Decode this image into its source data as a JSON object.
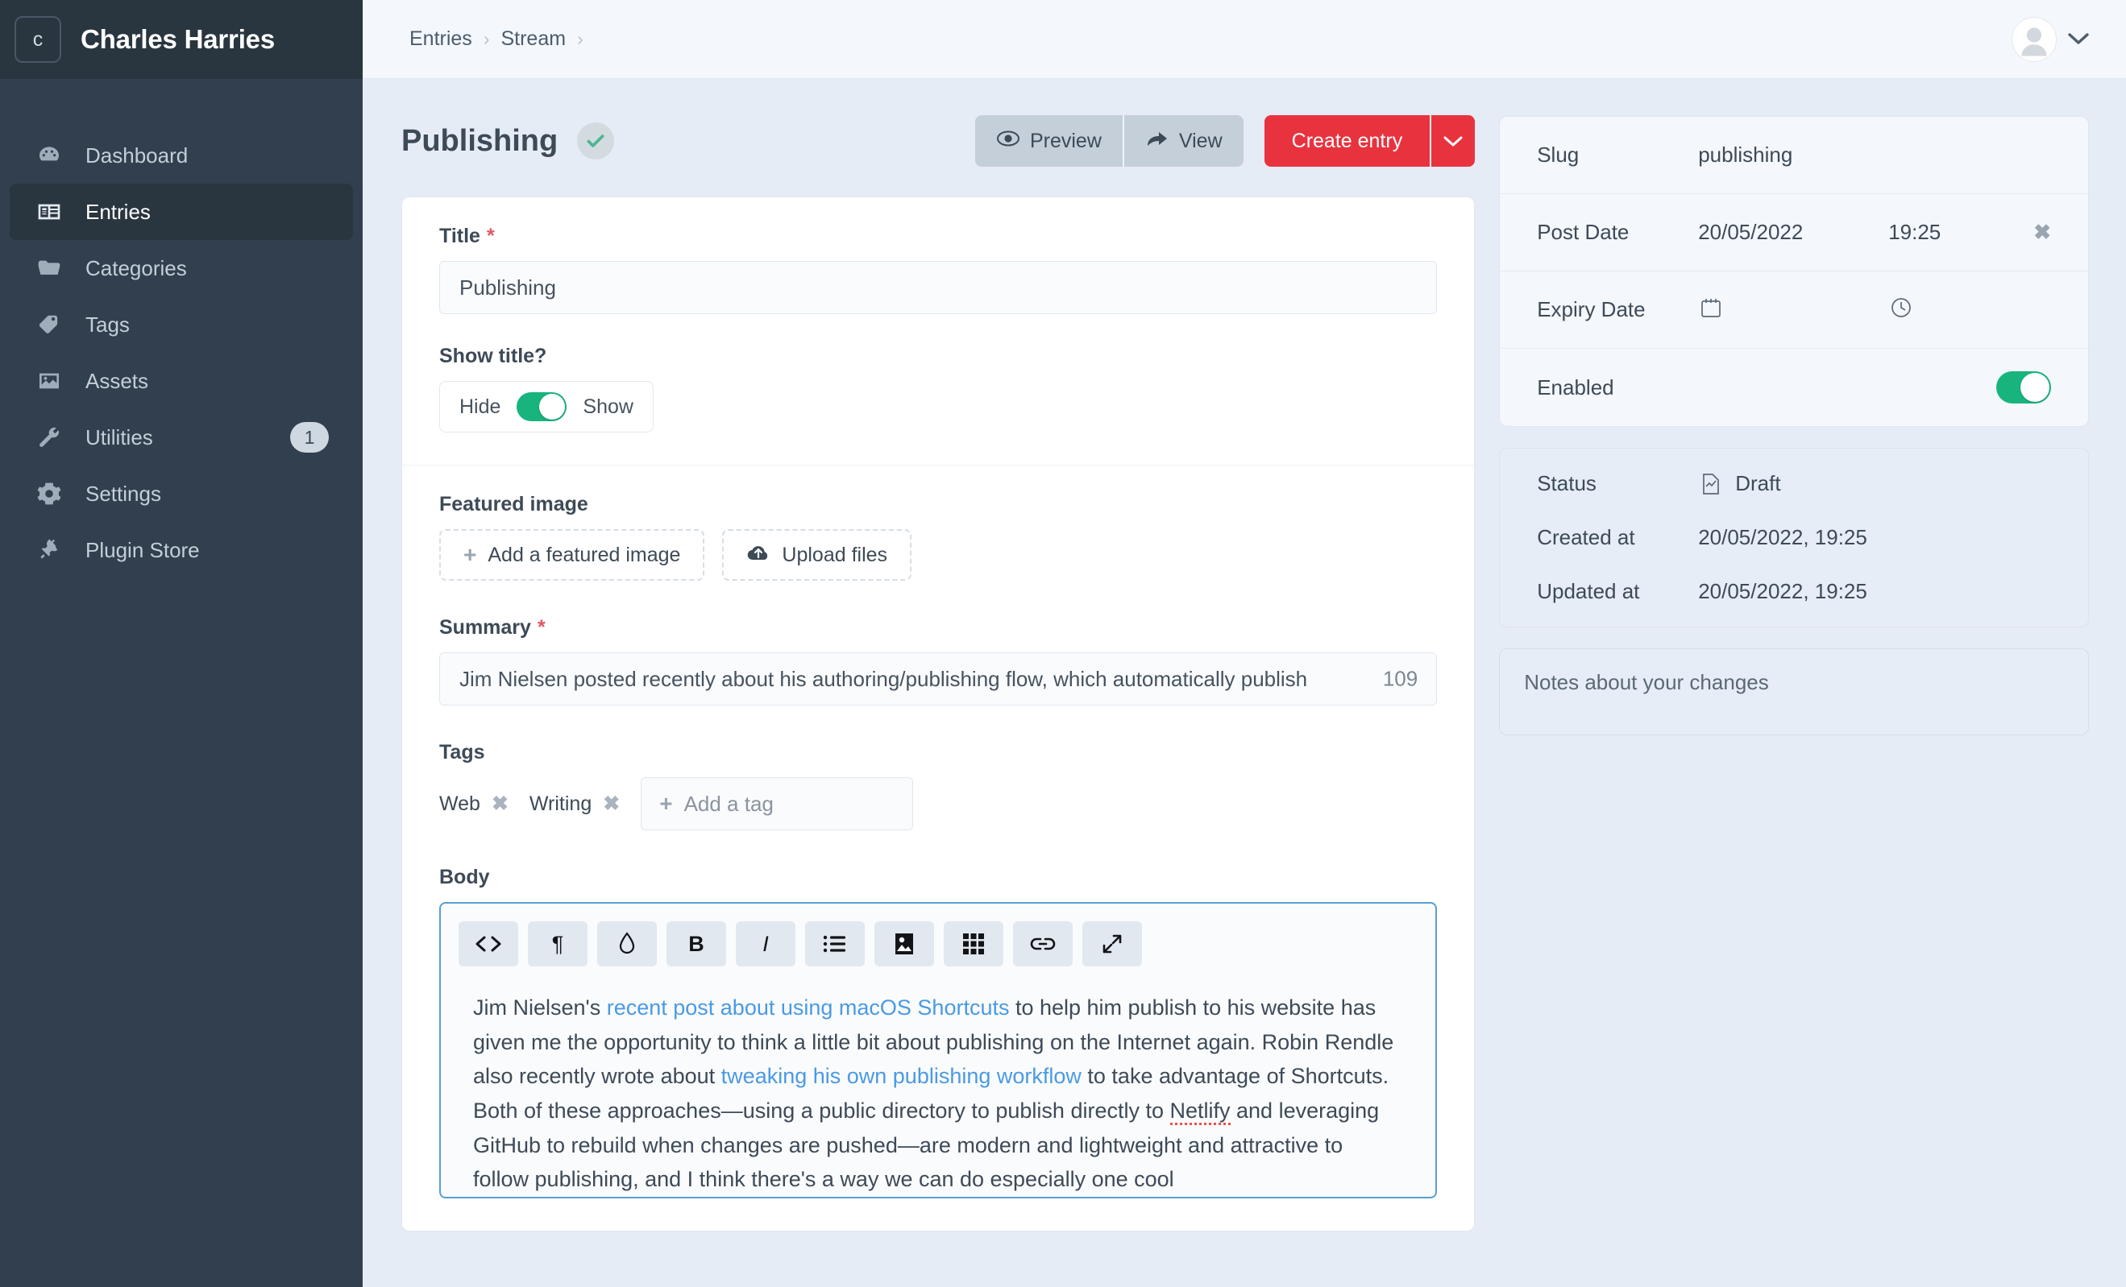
{
  "sidebar": {
    "brand": {
      "logo_letter": "c",
      "name": "Charles Harries"
    },
    "items": [
      {
        "label": "Dashboard",
        "icon": "dashboard-icon",
        "badge": ""
      },
      {
        "label": "Entries",
        "icon": "entries-icon",
        "badge": ""
      },
      {
        "label": "Categories",
        "icon": "folder-icon",
        "badge": ""
      },
      {
        "label": "Tags",
        "icon": "tag-icon",
        "badge": ""
      },
      {
        "label": "Assets",
        "icon": "image-icon",
        "badge": ""
      },
      {
        "label": "Utilities",
        "icon": "wrench-icon",
        "badge": "1"
      },
      {
        "label": "Settings",
        "icon": "gear-icon",
        "badge": ""
      },
      {
        "label": "Plugin Store",
        "icon": "plug-icon",
        "badge": ""
      }
    ]
  },
  "topbar": {
    "breadcrumb": [
      "Entries",
      "Stream"
    ],
    "separator": "›",
    "avatar_caret": "⌄"
  },
  "page": {
    "title": "Publishing",
    "saved_icon": "check-icon",
    "actions": {
      "preview": "Preview",
      "view": "View",
      "create": "Create entry",
      "create_caret": "⌄"
    }
  },
  "form": {
    "title_field": {
      "label": "Title",
      "required": "*",
      "value": "Publishing"
    },
    "show_title": {
      "label": "Show title?",
      "off_label": "Hide",
      "on_label": "Show",
      "state": "on"
    },
    "featured_image": {
      "label": "Featured image",
      "add_label": "Add a featured image",
      "upload_label": "Upload files"
    },
    "summary": {
      "label": "Summary",
      "required": "*",
      "value": "Jim Nielsen posted recently about his authoring/publishing flow, which automatically publish",
      "char_count": "109"
    },
    "tags": {
      "label": "Tags",
      "chips": [
        "Web",
        "Writing"
      ],
      "remove_glyph": "✖",
      "add_placeholder": "Add a tag"
    },
    "body": {
      "label": "Body",
      "toolbar": [
        {
          "name": "code-icon",
          "glyph": "<>"
        },
        {
          "name": "paragraph-icon",
          "glyph": "¶"
        },
        {
          "name": "droplet-icon",
          "glyph": "◊"
        },
        {
          "name": "bold-icon",
          "glyph": "B"
        },
        {
          "name": "italic-icon",
          "glyph": "I"
        },
        {
          "name": "bullet-list-icon",
          "glyph": "☰"
        },
        {
          "name": "image-icon",
          "glyph": "▣"
        },
        {
          "name": "grid-icon",
          "glyph": "☷"
        },
        {
          "name": "link-icon",
          "glyph": "⚭"
        },
        {
          "name": "expand-icon",
          "glyph": "⤡"
        }
      ],
      "paragraph": {
        "t1": "Jim Nielsen's ",
        "link1": "recent post about using macOS Shortcuts",
        "t2": " to help him publish to his website has given me the opportunity to think a little bit about publishing on the Internet again. Robin Rendle also recently wrote about ",
        "link2": "tweaking his own publishing workflow",
        "t3": " to take advantage of Shortcuts. Both of these approaches—using a public directory to publish directly to ",
        "misspelled": "Netlify",
        "t4": " and leveraging GitHub to rebuild when changes are pushed—are modern and lightweight and attractive to follow publishing, and I think there's a way we can do especially one cool"
      }
    }
  },
  "side_panel": {
    "slug": {
      "key": "Slug",
      "value": "publishing"
    },
    "post_date": {
      "key": "Post Date",
      "date": "20/05/2022",
      "time": "19:25",
      "clear": "✖"
    },
    "expiry_date": {
      "key": "Expiry Date",
      "date_icon": "calendar-icon",
      "time_icon": "clock-icon"
    },
    "enabled": {
      "key": "Enabled",
      "state": "on"
    }
  },
  "meta_panel": {
    "status": {
      "key": "Status",
      "icon": "draft-file-icon",
      "value": "Draft"
    },
    "created_at": {
      "key": "Created at",
      "value": "20/05/2022, 19:25"
    },
    "updated_at": {
      "key": "Updated at",
      "value": "20/05/2022, 19:25"
    }
  },
  "notes": {
    "placeholder": "Notes about your changes"
  }
}
